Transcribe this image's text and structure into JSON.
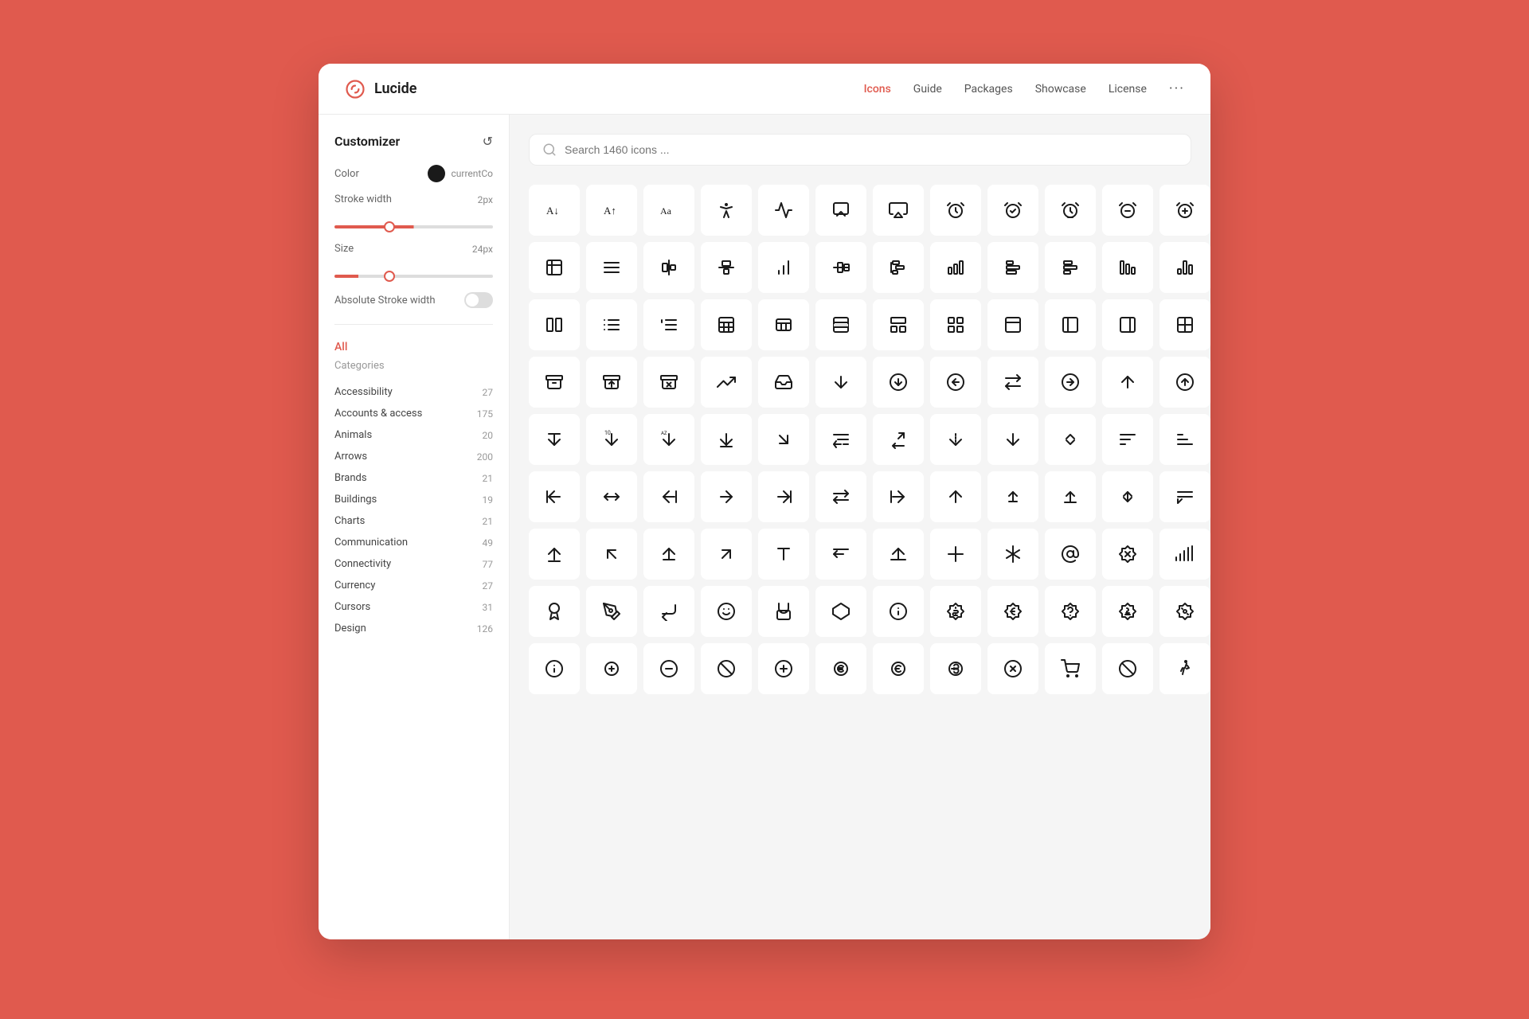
{
  "header": {
    "logo_text": "Lucide",
    "nav_items": [
      {
        "label": "Icons",
        "active": true
      },
      {
        "label": "Guide",
        "active": false
      },
      {
        "label": "Packages",
        "active": false
      },
      {
        "label": "Showcase",
        "active": false
      },
      {
        "label": "License",
        "active": false
      }
    ],
    "more_label": "···"
  },
  "sidebar": {
    "customizer_title": "Customizer",
    "color_label": "Color",
    "color_value": "currentCo",
    "stroke_label": "Stroke width",
    "stroke_value": "2px",
    "size_label": "Size",
    "size_value": "24px",
    "abs_stroke_label": "Absolute Stroke width",
    "all_label": "All",
    "categories_label": "Categories",
    "categories": [
      {
        "name": "Accessibility",
        "count": 27
      },
      {
        "name": "Accounts & access",
        "count": 175
      },
      {
        "name": "Animals",
        "count": 20
      },
      {
        "name": "Arrows",
        "count": 200
      },
      {
        "name": "Brands",
        "count": 21
      },
      {
        "name": "Buildings",
        "count": 19
      },
      {
        "name": "Charts",
        "count": 21
      },
      {
        "name": "Communication",
        "count": 49
      },
      {
        "name": "Connectivity",
        "count": 77
      },
      {
        "name": "Currency",
        "count": 27
      },
      {
        "name": "Cursors",
        "count": 31
      },
      {
        "name": "Design",
        "count": 126
      }
    ]
  },
  "search": {
    "placeholder": "Search 1460 icons ..."
  },
  "colors": {
    "accent": "#E05A4E",
    "bg": "#f5f5f5",
    "white": "#ffffff"
  }
}
